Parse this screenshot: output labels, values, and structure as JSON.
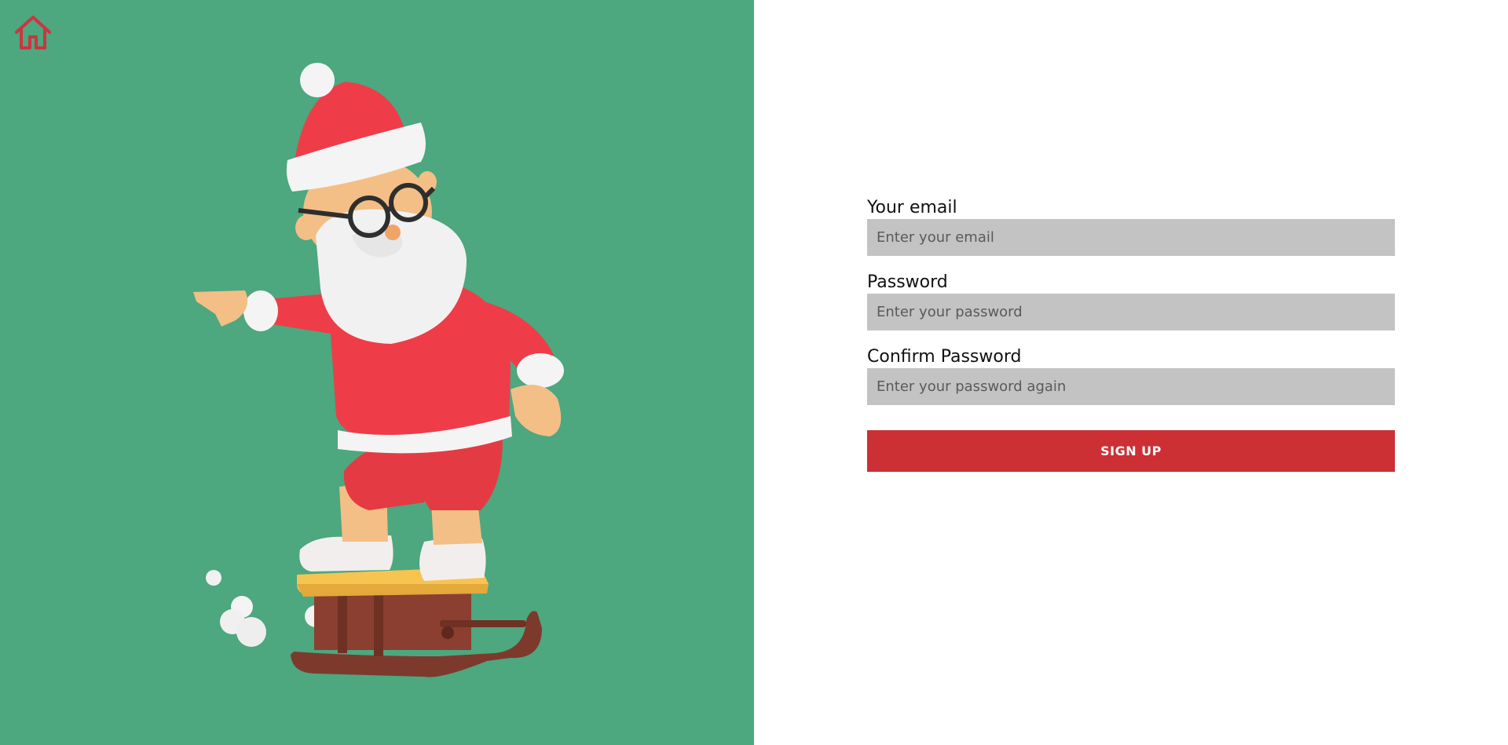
{
  "nav": {
    "home_icon": "home-icon",
    "home_icon_color": "#cc3540"
  },
  "hero": {
    "background_color": "#4da77f",
    "illustration": "santa-on-sled-illustration"
  },
  "form": {
    "email": {
      "label": "Your email",
      "placeholder": "Enter your email",
      "value": ""
    },
    "password": {
      "label": "Password",
      "placeholder": "Enter your password",
      "value": ""
    },
    "confirm_password": {
      "label": "Confirm Password",
      "placeholder": "Enter your password again",
      "value": ""
    },
    "submit_label": "SIGN UP",
    "input_background": "#c3c3c3",
    "button_color": "#cc3035"
  }
}
